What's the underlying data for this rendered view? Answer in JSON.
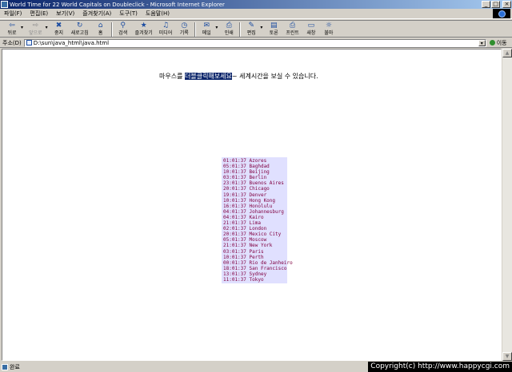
{
  "window": {
    "title": "World Time for 22 World Capitals on Doubleclick - Microsoft Internet Explorer",
    "minimize_glyph": "_",
    "maximize_glyph": "□",
    "close_glyph": "×"
  },
  "menubar": {
    "items": [
      "파일(F)",
      "편집(E)",
      "보기(V)",
      "즐겨찾기(A)",
      "도구(T)",
      "도움말(H)"
    ]
  },
  "toolbar": {
    "buttons": [
      {
        "label": "뒤로",
        "icon": "back-arrow-icon",
        "glyph": "⇦",
        "enabled": true
      },
      {
        "label": "앞으로",
        "icon": "forward-arrow-icon",
        "glyph": "⇨",
        "enabled": false
      },
      {
        "label": "중지",
        "icon": "stop-icon",
        "glyph": "✖"
      },
      {
        "label": "새로고침",
        "icon": "refresh-icon",
        "glyph": "↻"
      },
      {
        "label": "홈",
        "icon": "home-icon",
        "glyph": "⌂"
      },
      {
        "label": "검색",
        "icon": "search-icon",
        "glyph": "⚲"
      },
      {
        "label": "즐겨찾기",
        "icon": "favorites-icon",
        "glyph": "★"
      },
      {
        "label": "미디어",
        "icon": "media-icon",
        "glyph": "♫"
      },
      {
        "label": "기록",
        "icon": "history-icon",
        "glyph": "◷"
      },
      {
        "label": "메일",
        "icon": "mail-icon",
        "glyph": "✉"
      },
      {
        "label": "인쇄",
        "icon": "print-icon",
        "glyph": "⎙"
      },
      {
        "label": "편집",
        "icon": "edit-icon",
        "glyph": "✎"
      },
      {
        "label": "토론",
        "icon": "discuss-icon",
        "glyph": "▤"
      },
      {
        "label": "프린트",
        "icon": "printer-icon",
        "glyph": "⎙"
      },
      {
        "label": "새창",
        "icon": "new-window-icon",
        "glyph": "▭"
      },
      {
        "label": "불마",
        "icon": "lightbulb-icon",
        "glyph": "☼"
      }
    ]
  },
  "addressbar": {
    "label": "주소(D)",
    "url": "D:\\sun\\java_html\\java.html",
    "go_label": "이동"
  },
  "content": {
    "instruction_before": "마우스를 ",
    "instruction_highlight": "더블클릭해보세요",
    "instruction_after": "~ 세계시간을 보실 수 있습니다.",
    "times": [
      "01:01:37 Azores",
      "05:01:37 Baghdad",
      "10:01:37 Beijing",
      "03:01:37 Berlin",
      "23:01:37 Buenos Aires",
      "20:01:37 Chicago",
      "19:01:37 Denver",
      "10:01:37 Hong Kong",
      "16:01:37 Honolulu",
      "04:01:37 Johannesburg",
      "04:01:37 Kairo",
      "21:01:37 Lima",
      "02:01:37 London",
      "20:01:37 Mexico City",
      "05:01:37 Moscow",
      "21:01:37 New York",
      "03:01:37 Paris",
      "10:01:37 Perth",
      "00:01:37 Rio de Janheiro",
      "18:01:37 San Francisco",
      "13:01:37 Sydney",
      "11:01:37 Tokyo"
    ]
  },
  "statusbar": {
    "status": "완료",
    "copyright": "Copyright(c) http://www.happycgi.com"
  },
  "colors": {
    "titlebar_start": "#0a246a",
    "highlight": "#0a246a",
    "time_text": "#800040",
    "time_bg": "#e0e0ff"
  }
}
